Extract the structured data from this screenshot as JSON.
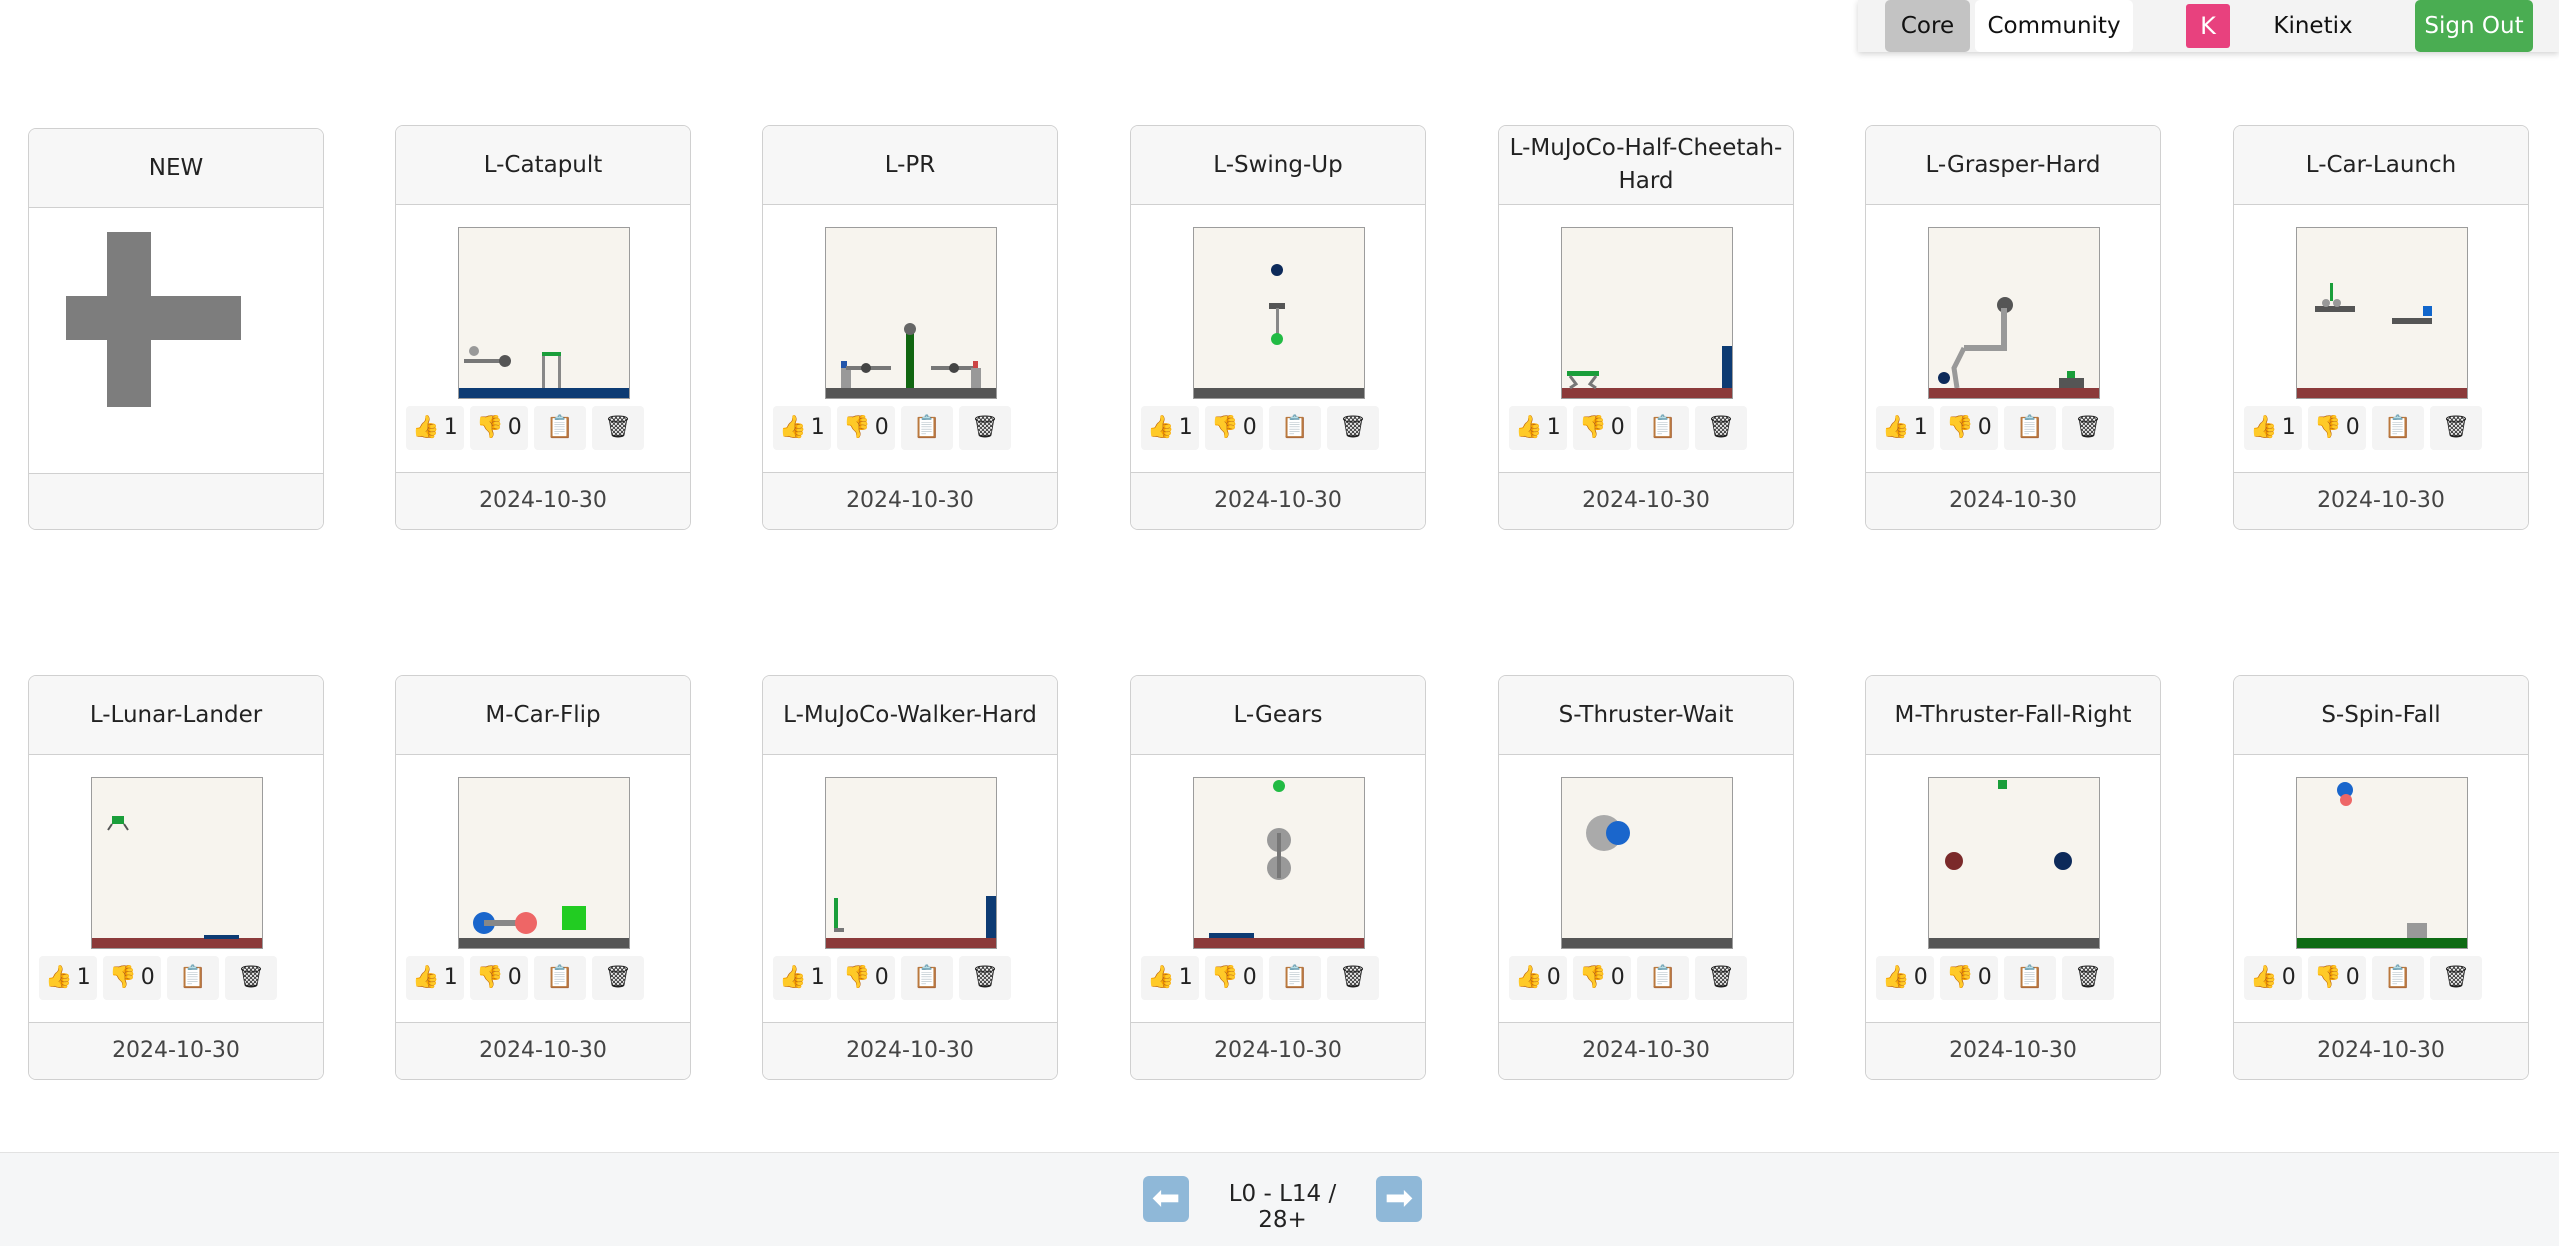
{
  "nav": {
    "core_label": "Core",
    "community_label": "Community",
    "avatar_letter": "K",
    "username": "Kinetix",
    "signout_label": "Sign Out"
  },
  "new_card": {
    "title": "NEW"
  },
  "levels": [
    {
      "title": "L-Catapult",
      "likes": "1",
      "dislikes": "0",
      "date": "2024-10-30"
    },
    {
      "title": "L-PR",
      "likes": "1",
      "dislikes": "0",
      "date": "2024-10-30"
    },
    {
      "title": "L-Swing-Up",
      "likes": "1",
      "dislikes": "0",
      "date": "2024-10-30"
    },
    {
      "title": "L-MuJoCo-Half-Cheetah-Hard",
      "likes": "1",
      "dislikes": "0",
      "date": "2024-10-30"
    },
    {
      "title": "L-Grasper-Hard",
      "likes": "1",
      "dislikes": "0",
      "date": "2024-10-30"
    },
    {
      "title": "L-Car-Launch",
      "likes": "1",
      "dislikes": "0",
      "date": "2024-10-30"
    },
    {
      "title": "L-Lunar-Lander",
      "likes": "1",
      "dislikes": "0",
      "date": "2024-10-30"
    },
    {
      "title": "M-Car-Flip",
      "likes": "1",
      "dislikes": "0",
      "date": "2024-10-30"
    },
    {
      "title": "L-MuJoCo-Walker-Hard",
      "likes": "1",
      "dislikes": "0",
      "date": "2024-10-30"
    },
    {
      "title": "L-Gears",
      "likes": "1",
      "dislikes": "0",
      "date": "2024-10-30"
    },
    {
      "title": "S-Thruster-Wait",
      "likes": "0",
      "dislikes": "0",
      "date": "2024-10-30"
    },
    {
      "title": "M-Thruster-Fall-Right",
      "likes": "0",
      "dislikes": "0",
      "date": "2024-10-30"
    },
    {
      "title": "S-Spin-Fall",
      "likes": "0",
      "dislikes": "0",
      "date": "2024-10-30"
    }
  ],
  "icons": {
    "like": "thumbs-up-icon",
    "dislike": "thumbs-down-icon",
    "copy": "clipboard-icon",
    "delete": "trash-icon"
  },
  "pager": {
    "prev_glyph": "⬅",
    "next_glyph": "➡",
    "range_label": "L0 - L14 / 28+"
  },
  "colors": {
    "signout": "#4aad52",
    "avatar": "#e8417e",
    "thumbnail_bg": "#f7f4ee",
    "floor_blue": "#0d3b73",
    "floor_red": "#8b3a3a",
    "floor_gray": "#555555",
    "floor_green": "#0e6b14"
  }
}
